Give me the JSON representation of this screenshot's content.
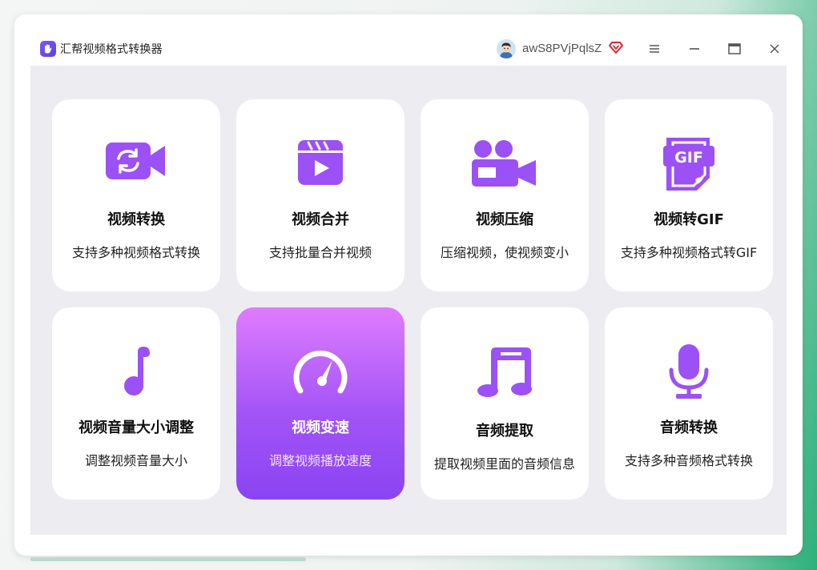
{
  "app": {
    "title": "汇帮视频格式转换器",
    "username": "awS8PVjPqlsZ",
    "accent_color": "#9b51f6",
    "icons": {
      "logo": "hand-logo-icon",
      "vip": "vip-diamond-icon",
      "menu": "hamburger-menu-icon",
      "minimize": "minimize-icon",
      "maximize": "maximize-icon",
      "close": "close-icon"
    }
  },
  "cards": [
    {
      "title": "视频转换",
      "desc": "支持多种视频格式转换",
      "icon": "video-convert-icon"
    },
    {
      "title": "视频合并",
      "desc": "支持批量合并视频",
      "icon": "clapperboard-play-icon"
    },
    {
      "title": "视频压缩",
      "desc": "压缩视频，使视频变小",
      "icon": "movie-camera-icon"
    },
    {
      "title": "视频转GIF",
      "desc": "支持多种视频格式转GIF",
      "icon": "gif-document-icon"
    },
    {
      "title": "视频音量大小调整",
      "desc": "调整视频音量大小",
      "icon": "music-note-icon"
    },
    {
      "title": "视频变速",
      "desc": "调整视频播放速度",
      "icon": "speedometer-icon",
      "selected": true
    },
    {
      "title": "音频提取",
      "desc": "提取视频里面的音频信息",
      "icon": "double-music-note-icon"
    },
    {
      "title": "音频转换",
      "desc": "支持多种音频格式转换",
      "icon": "microphone-icon"
    }
  ]
}
